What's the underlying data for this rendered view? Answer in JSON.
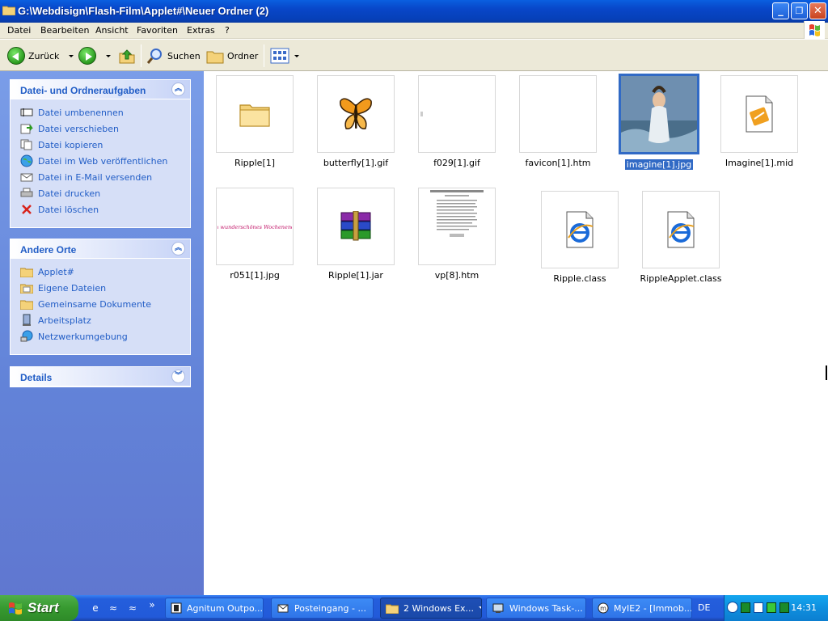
{
  "window": {
    "title": "G:\\Webdisign\\Flash-Film\\Applet#\\Neuer Ordner (2)",
    "minimize_glyph": "_",
    "maximize_glyph": "❐",
    "close_glyph": "✕"
  },
  "menu": [
    "Datei",
    "Bearbeiten",
    "Ansicht",
    "Favoriten",
    "Extras",
    "?"
  ],
  "toolbar": {
    "back_label": "Zurück",
    "search_label": "Suchen",
    "folders_label": "Ordner"
  },
  "task_panels": [
    {
      "title": "Datei- und Ordneraufgaben",
      "items": [
        {
          "label": "Datei umbenennen",
          "icon": "rename-icon"
        },
        {
          "label": "Datei verschieben",
          "icon": "move-icon"
        },
        {
          "label": "Datei kopieren",
          "icon": "copy-icon"
        },
        {
          "label": "Datei im Web veröffentlichen",
          "icon": "web-publish-icon"
        },
        {
          "label": "Datei in E-Mail versenden",
          "icon": "email-icon"
        },
        {
          "label": "Datei drucken",
          "icon": "printer-icon"
        },
        {
          "label": "Datei löschen",
          "icon": "delete-icon"
        }
      ]
    },
    {
      "title": "Andere Orte",
      "items": [
        {
          "label": "Applet#",
          "icon": "folder-icon"
        },
        {
          "label": "Eigene Dateien",
          "icon": "my-documents-icon"
        },
        {
          "label": "Gemeinsame Dokumente",
          "icon": "folder-icon"
        },
        {
          "label": "Arbeitsplatz",
          "icon": "my-computer-icon"
        },
        {
          "label": "Netzwerkumgebung",
          "icon": "network-icon"
        }
      ]
    },
    {
      "title": "Details",
      "items": []
    }
  ],
  "files": [
    {
      "name": "Ripple[1]",
      "type": "folder"
    },
    {
      "name": "butterfly[1].gif",
      "type": "butterfly-image"
    },
    {
      "name": "f029[1].gif",
      "type": "blank-image"
    },
    {
      "name": "favicon[1].htm",
      "type": "blank"
    },
    {
      "name": "imagine[1].jpg",
      "type": "photo",
      "selected": true
    },
    {
      "name": "Imagine[1].mid",
      "type": "midi"
    },
    {
      "name": "r051[1].jpg",
      "type": "text-banner-image",
      "banner_text": "Ein wunderschönes Wochenende!"
    },
    {
      "name": "Ripple[1].jar",
      "type": "winrar-archive"
    },
    {
      "name": "vp[8].htm",
      "type": "document-preview"
    },
    {
      "name": "Ripple.class",
      "type": "ie-document"
    },
    {
      "name": "RippleApplet.class",
      "type": "ie-document"
    }
  ],
  "taskbar": {
    "start_label": "Start",
    "buttons": [
      {
        "label": "Agnitum Outpo...",
        "icon": "outpost-icon"
      },
      {
        "label": "Posteingang - ...",
        "icon": "outlook-icon"
      },
      {
        "label": "2 Windows Ex...",
        "icon": "folder-icon",
        "active": true
      },
      {
        "label": "Windows Task-...",
        "icon": "task-manager-icon"
      },
      {
        "label": "MyIE2 - [Immob...",
        "icon": "myie2-icon"
      }
    ],
    "language": "DE",
    "clock": "14:31"
  },
  "colors": {
    "titlebar": "#0846c8",
    "taskpane_link": "#215dc6",
    "selection": "#316ac5",
    "start_button": "#379a30"
  }
}
